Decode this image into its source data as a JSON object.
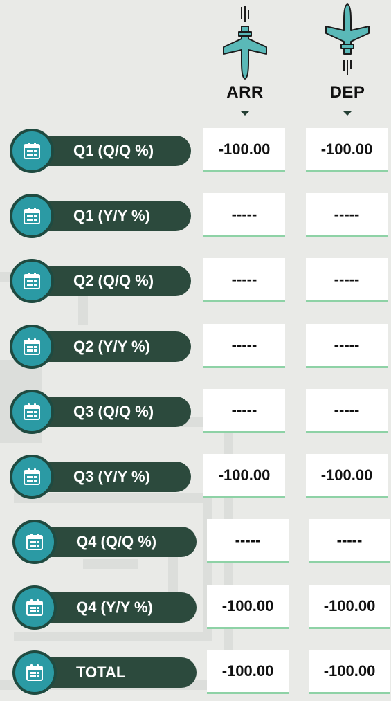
{
  "columns": {
    "arrivals": {
      "label": "ARR",
      "icon": "airplane-landing-icon"
    },
    "departures": {
      "label": "DEP",
      "icon": "airplane-takeoff-icon"
    }
  },
  "rows": [
    {
      "label": "Q1 (Q/Q %)",
      "arr": "-100.00",
      "dep": "-100.00"
    },
    {
      "label": "Q1 (Y/Y %)",
      "arr": "-----",
      "dep": "-----"
    },
    {
      "label": "Q2 (Q/Q %)",
      "arr": "-----",
      "dep": "-----"
    },
    {
      "label": "Q2 (Y/Y %)",
      "arr": "-----",
      "dep": "-----"
    },
    {
      "label": "Q3 (Q/Q %)",
      "arr": "-----",
      "dep": "-----"
    },
    {
      "label": "Q3 (Y/Y %)",
      "arr": "-100.00",
      "dep": "-100.00"
    },
    {
      "label": "Q4 (Q/Q %)",
      "arr": "-----",
      "dep": "-----"
    },
    {
      "label": "Q4 (Y/Y %)",
      "arr": "-100.00",
      "dep": "-100.00"
    },
    {
      "label": "TOTAL",
      "arr": "-100.00",
      "dep": "-100.00"
    }
  ],
  "colors": {
    "background": "#e9eae7",
    "pill": "#2c4a3d",
    "circle": "#2b9aa4",
    "cell_underline": "#8ed2a6"
  }
}
